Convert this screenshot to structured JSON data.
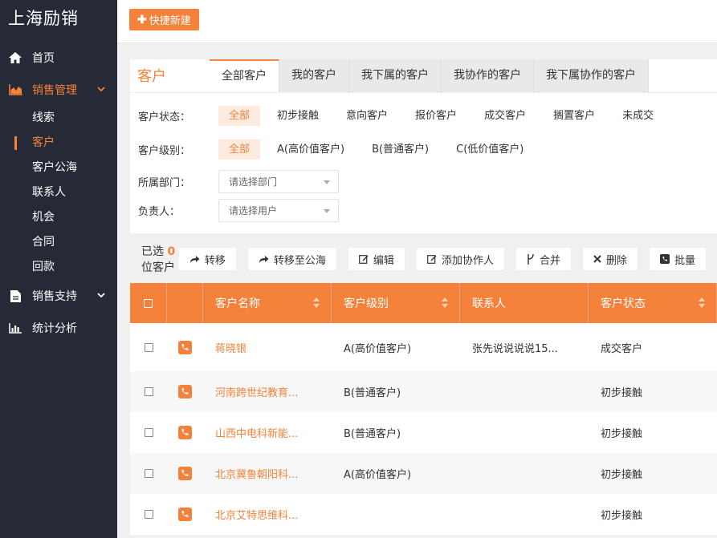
{
  "sidebar": {
    "brand": "上海励销",
    "items": [
      {
        "label": "首页",
        "icon": "home-icon"
      },
      {
        "label": "销售管理",
        "icon": "area-chart-icon"
      },
      {
        "label": "销售支持",
        "icon": "file-icon"
      },
      {
        "label": "统计分析",
        "icon": "bar-chart-icon"
      }
    ],
    "sales_sub": [
      "线索",
      "客户",
      "客户公海",
      "联系人",
      "机会",
      "合同",
      "回款"
    ],
    "active_sub": "客户"
  },
  "topbar": {
    "quick_create": "快捷新建"
  },
  "panel": {
    "title": "客户",
    "tabs": [
      "全部客户",
      "我的客户",
      "我下属的客户",
      "我协作的客户",
      "我下属协作的客户"
    ],
    "filters": {
      "status_label": "客户状态：",
      "status_options": [
        "全部",
        "初步接触",
        "意向客户",
        "报价客户",
        "成交客户",
        "搁置客户",
        "未成交"
      ],
      "level_label": "客户级别：",
      "level_options": [
        "全部",
        "A(高价值客户)",
        "B(普通客户)",
        "C(低价值客户)"
      ],
      "dept_label": "所属部门：",
      "dept_placeholder": "请选择部门",
      "owner_label": "负责人：",
      "owner_placeholder": "请选择用户"
    }
  },
  "actions": {
    "selected_prefix": "已选",
    "selected_count": "0",
    "selected_suffix": "位客户",
    "buttons": [
      "转移",
      "转移至公海",
      "编辑",
      "添加协作人",
      "合并",
      "删除",
      "批量"
    ]
  },
  "table": {
    "columns": [
      "客户名称",
      "客户级别",
      "联系人",
      "客户状态"
    ],
    "rows": [
      {
        "name": "蒋晓银",
        "level": "A(高价值客户)",
        "contact": "张先说说说说15...",
        "status": "成交客户"
      },
      {
        "name": "河南跨世纪教育...",
        "level": "B(普通客户)",
        "contact": "",
        "status": "初步接触"
      },
      {
        "name": "山西中电科新能...",
        "level": "B(普通客户)",
        "contact": "",
        "status": "初步接触"
      },
      {
        "name": "北京冀鲁朝阳科...",
        "level": "A(高价值客户)",
        "contact": "",
        "status": "初步接触"
      },
      {
        "name": "北京艾特思维科...",
        "level": "",
        "contact": "",
        "status": "初步接触"
      }
    ]
  },
  "colors": {
    "accent": "#f5823a",
    "sidebar_bg": "#252a36",
    "highlight_box": "#2b55c4"
  }
}
